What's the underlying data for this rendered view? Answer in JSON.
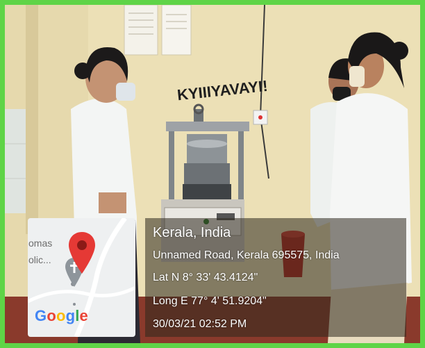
{
  "location": {
    "title": "Kerala, India",
    "address": "Unnamed Road, Kerala 695575, India",
    "latitude": "Lat N 8° 33' 43.4124\"",
    "longitude": "Long E 77° 4' 51.9204\"",
    "datetime": "30/03/21 02:52 PM"
  },
  "map": {
    "place_line1": "omas",
    "place_line2": "olic...",
    "logo_letters": [
      "G",
      "o",
      "o",
      "g",
      "l",
      "e"
    ],
    "logo_colors": [
      "#4285f4",
      "#ea4335",
      "#fbbc05",
      "#4285f4",
      "#34a853",
      "#ea4335"
    ],
    "pin_color": "#e53935"
  },
  "photo": {
    "wall_sign": "KYIIIYAVAYI!"
  },
  "colors": {
    "border": "#5fd447"
  }
}
